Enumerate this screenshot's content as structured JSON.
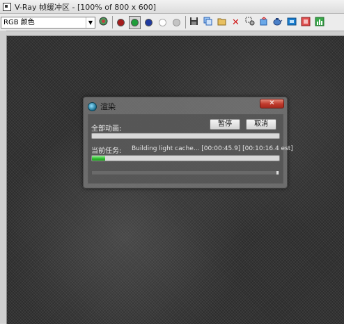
{
  "window": {
    "title": "V-Ray 帧缓冲区 - [100% of 800 x 600]"
  },
  "toolbar": {
    "channel": "RGB 颜色",
    "buttons": [
      {
        "name": "color-correction-icon",
        "color": "#4a6fb0"
      },
      {
        "name": "red-channel-icon",
        "color": "#b02020"
      },
      {
        "name": "green-channel-icon",
        "color": "#1f9d3a"
      },
      {
        "name": "blue-channel-icon",
        "color": "#1f3aa0"
      },
      {
        "name": "alpha-channel-icon",
        "color": "#ffffff"
      },
      {
        "name": "monochrome-icon",
        "color": "#b8b8b8"
      },
      {
        "name": "save-icon",
        "color": "#333333"
      },
      {
        "name": "copy-icon",
        "color": "#2a64b8"
      },
      {
        "name": "open-folder-icon",
        "color": "#c9a030"
      },
      {
        "name": "clear-icon",
        "color": "#d01818"
      },
      {
        "name": "region-render-icon",
        "color": "#444444"
      },
      {
        "name": "track-mouse-icon",
        "color": "#1e7bd6"
      },
      {
        "name": "teapot-render-icon",
        "color": "#2a6ac0"
      },
      {
        "name": "display-correction-icon",
        "color": "#1a7fd0"
      },
      {
        "name": "lut-icon",
        "color": "#d23a3a"
      },
      {
        "name": "histogram-icon",
        "color": "#1f9d3a"
      }
    ]
  },
  "dialog": {
    "title": "渲染",
    "close_label": "✕",
    "overall_label": "全部动画:",
    "pause_label": "暂停",
    "cancel_label": "取消",
    "current_task_label": "当前任务:",
    "current_task_text": "Building light cache... [00:00:45.9] [00:10:16.4 est]",
    "overall_progress": 0.0,
    "task_progress": 0.07
  }
}
